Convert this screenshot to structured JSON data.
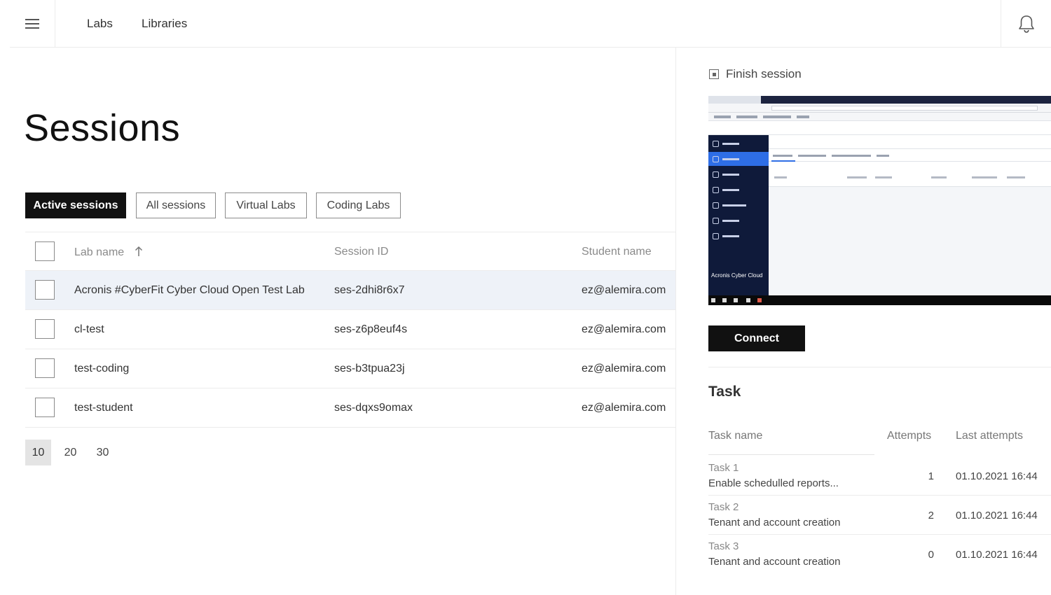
{
  "nav": {
    "labs": "Labs",
    "libraries": "Libraries"
  },
  "page": {
    "title": "Sessions"
  },
  "filters": [
    {
      "label": "Active sessions",
      "active": true
    },
    {
      "label": "All sessions",
      "active": false
    },
    {
      "label": "Virtual Labs",
      "active": false
    },
    {
      "label": "Coding Labs",
      "active": false
    }
  ],
  "table": {
    "columns": {
      "lab_name": "Lab name",
      "session_id": "Session ID",
      "student_name": "Student name"
    },
    "rows": [
      {
        "lab_name": "Acronis #CyberFit Cyber Cloud Open Test Lab",
        "session_id": "ses-2dhi8r6x7",
        "student": "ez@alemira.com"
      },
      {
        "lab_name": "cl-test",
        "session_id": "ses-z6p8euf4s",
        "student": "ez@alemira.com"
      },
      {
        "lab_name": "test-coding",
        "session_id": "ses-b3tpua23j",
        "student": "ez@alemira.com"
      },
      {
        "lab_name": "test-student",
        "session_id": "ses-dqxs9omax",
        "student": "ez@alemira.com"
      }
    ]
  },
  "pagination": {
    "sizes": [
      "10",
      "20",
      "30"
    ],
    "active": "10"
  },
  "panel": {
    "finish_label": "Finish session",
    "preview_brand": "Acronis Cyber Cloud",
    "connect_label": "Connect",
    "task_title": "Task",
    "task_columns": {
      "name": "Task name",
      "attempts": "Attempts",
      "last": "Last attempts"
    },
    "tasks": [
      {
        "num": "Task 1",
        "desc": "Enable schedulled reports...",
        "attempts": "1",
        "last": "01.10.2021 16:44"
      },
      {
        "num": "Task 2",
        "desc": "Tenant and account creation",
        "attempts": "2",
        "last": "01.10.2021 16:44"
      },
      {
        "num": "Task 3",
        "desc": "Tenant and account creation",
        "attempts": "0",
        "last": "01.10.2021 16:44"
      }
    ]
  },
  "icons": {
    "menu": "hamburger-menu-icon",
    "bell": "bell-icon",
    "sort": "arrow-up-icon",
    "finish": "stop-square-icon"
  },
  "colors": {
    "primary": "#111111",
    "row_highlight": "#eef2f8",
    "preview_sidebar": "#0f1a3a",
    "preview_accent": "#2e6ee6"
  }
}
